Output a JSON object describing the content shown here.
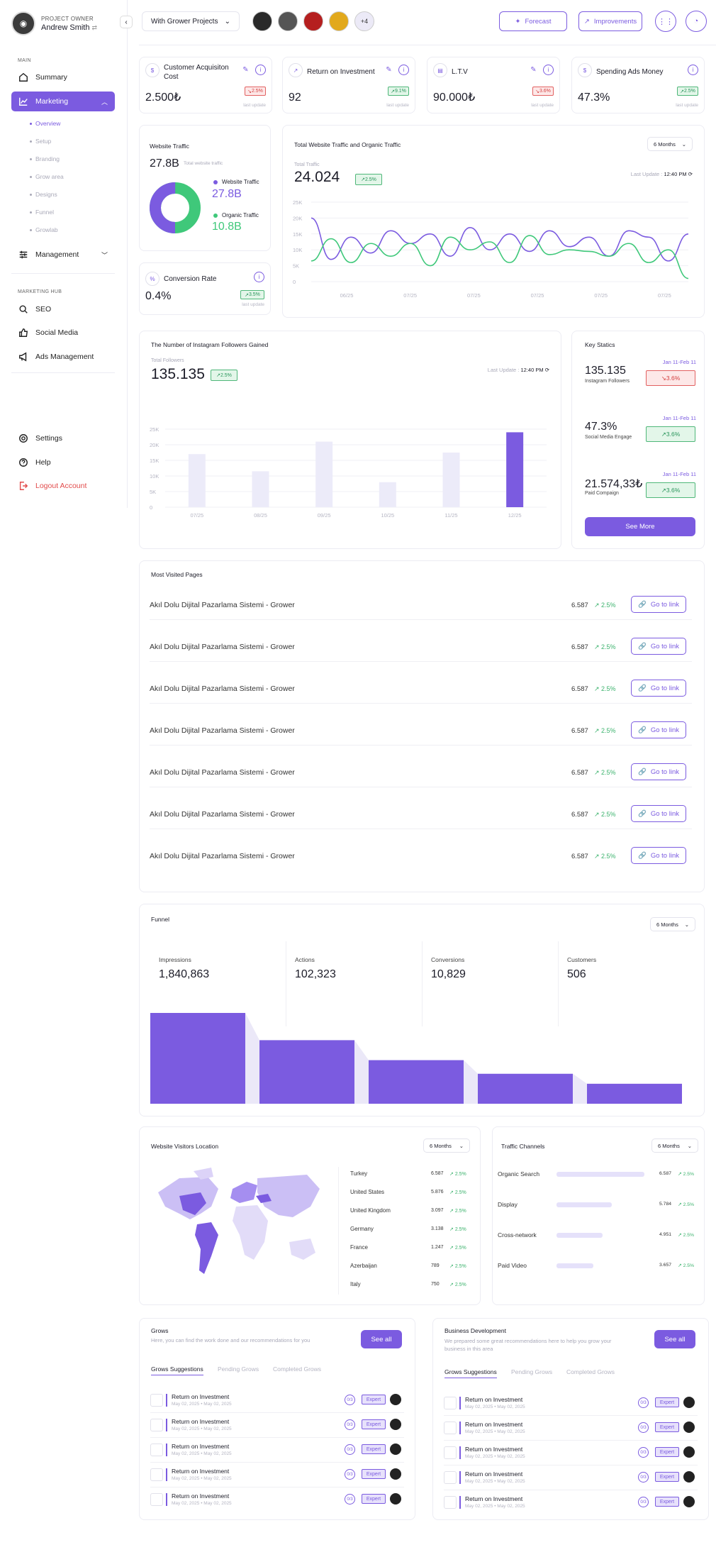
{
  "user": {
    "role": "PROJECT OWNER",
    "name": "Andrew Smith"
  },
  "nav": {
    "main_label": "MAIN",
    "summary": "Summary",
    "marketing": "Marketing",
    "sub": [
      "Overview",
      "Setup",
      "Branding",
      "Grow area",
      "Designs",
      "Funnel",
      "Growlab"
    ],
    "management": "Management",
    "hub_label": "MARKETING HUB",
    "seo": "SEO",
    "social": "Social Media",
    "ads": "Ads Management",
    "settings": "Settings",
    "help": "Help",
    "logout": "Logout Account"
  },
  "topbar": {
    "project": "With Grower Projects",
    "more_people": "+4",
    "forecast": "Forecast",
    "improvements": "Improvements"
  },
  "kpis": [
    {
      "title": "Customer Acquisiton Cost",
      "value": "2.500₺",
      "change": "2.5%",
      "dir": "down",
      "note": "last update",
      "icon": "$"
    },
    {
      "title": "Return on Investment",
      "value": "92",
      "change": "9.1%",
      "dir": "up",
      "note": "last update",
      "icon": "↗"
    },
    {
      "title": "L.T.V",
      "value": "90.000₺",
      "change": "3.6%",
      "dir": "down",
      "note": "last update",
      "icon": "▤"
    },
    {
      "title": "Spending Ads Money",
      "value": "47.3%",
      "change": "2.5%",
      "dir": "up",
      "note": "last update",
      "icon": "$"
    }
  ],
  "website_traffic": {
    "title": "Website Traffic",
    "total": "27.8B",
    "total_label": "Total website traffic",
    "legend": [
      {
        "label": "Website Traffic",
        "value": "27.8B",
        "color": "#7b5be0"
      },
      {
        "label": "Organic Traffic",
        "value": "10.8B",
        "color": "#3fc87a"
      }
    ]
  },
  "conversion": {
    "title": "Conversion Rate",
    "value": "0.4%",
    "change": "3.5%",
    "note": "last update"
  },
  "traffic_chart": {
    "title": "Total Website Traffic and Organic Traffic",
    "period": "6 Months",
    "sub": "Total Traffic",
    "value": "24.024",
    "change": "2.5%",
    "last_update_label": "Last Update :",
    "last_update": "12:40 PM"
  },
  "instagram": {
    "title": "The Number of Instagram Followers Gained",
    "sub": "Total Followers",
    "value": "135.135",
    "change": "2.5%",
    "last_update_label": "Last Update :",
    "last_update": "12:40 PM"
  },
  "key_statics": {
    "title": "Key Statics",
    "items": [
      {
        "value": "135.135",
        "label": "Instagram Followers",
        "date": "Jan 11-Feb 11",
        "change": "3.6%",
        "dir": "down"
      },
      {
        "value": "47.3%",
        "label": "Social Media Engage",
        "date": "Jan 11-Feb 11",
        "change": "3.6%",
        "dir": "up"
      },
      {
        "value": "21.574,33₺",
        "label": "Paid Compaign",
        "date": "Jan 11-Feb 11",
        "change": "3.6%",
        "dir": "up"
      }
    ],
    "see_more": "See More"
  },
  "most_visited": {
    "title": "Most Visited Pages",
    "link_label": "Go to link",
    "rows": [
      {
        "page": "Akıl Dolu Dijital Pazarlama Sistemi - Grower",
        "count": "6.587",
        "change": "2.5%"
      },
      {
        "page": "Akıl Dolu Dijital Pazarlama Sistemi - Grower",
        "count": "6.587",
        "change": "2.5%"
      },
      {
        "page": "Akıl Dolu Dijital Pazarlama Sistemi - Grower",
        "count": "6.587",
        "change": "2.5%"
      },
      {
        "page": "Akıl Dolu Dijital Pazarlama Sistemi - Grower",
        "count": "6.587",
        "change": "2.5%"
      },
      {
        "page": "Akıl Dolu Dijital Pazarlama Sistemi - Grower",
        "count": "6.587",
        "change": "2.5%"
      },
      {
        "page": "Akıl Dolu Dijital Pazarlama Sistemi - Grower",
        "count": "6.587",
        "change": "2.5%"
      },
      {
        "page": "Akıl Dolu Dijital Pazarlama Sistemi - Grower",
        "count": "6.587",
        "change": "2.5%"
      }
    ]
  },
  "funnel": {
    "title": "Funnel",
    "period": "6 Months",
    "stages": [
      {
        "label": "Impressions",
        "value": "1,840,863"
      },
      {
        "label": "Actions",
        "value": "102,323"
      },
      {
        "label": "Conversions",
        "value": "10,829"
      },
      {
        "label": "Customers",
        "value": "506"
      }
    ]
  },
  "visitors_location": {
    "title": "Website Visitors Location",
    "period": "6 Months",
    "rows": [
      {
        "country": "Turkey",
        "value": "6.587",
        "change": "2.5%"
      },
      {
        "country": "United States",
        "value": "5.876",
        "change": "2.5%"
      },
      {
        "country": "United Kingdom",
        "value": "3.097",
        "change": "2.5%"
      },
      {
        "country": "Germany",
        "value": "3.138",
        "change": "2.5%"
      },
      {
        "country": "France",
        "value": "1.247",
        "change": "2.5%"
      },
      {
        "country": "Azerbaijan",
        "value": "789",
        "change": "2.5%"
      },
      {
        "country": "Italy",
        "value": "750",
        "change": "2.5%"
      }
    ]
  },
  "traffic_channels": {
    "title": "Traffic Channels",
    "period": "6 Months",
    "rows": [
      {
        "name": "Organic Search",
        "value": "6.587",
        "change": "2.5%",
        "fill": 0.95
      },
      {
        "name": "Display",
        "value": "5.784",
        "change": "2.5%",
        "fill": 0.6
      },
      {
        "name": "Cross-network",
        "value": "4.951",
        "change": "2.5%",
        "fill": 0.5
      },
      {
        "name": "Paid Video",
        "value": "3.657",
        "change": "2.5%",
        "fill": 0.4
      }
    ]
  },
  "grows": {
    "title": "Grows",
    "sub": "Here, you can find the work done and our recommendations for you",
    "see_all": "See all",
    "tabs": [
      "Grows Suggestions",
      "Pending Grows",
      "Completed Grows"
    ],
    "items": [
      {
        "title": "Return on Investment",
        "start": "May 02, 2025",
        "end": "May 02, 2025"
      },
      {
        "title": "Return on Investment",
        "start": "May 02, 2025",
        "end": "May 02, 2025"
      },
      {
        "title": "Return on Investment",
        "start": "May 02, 2025",
        "end": "May 02, 2025"
      },
      {
        "title": "Return on Investment",
        "start": "May 02, 2025",
        "end": "May 02, 2025"
      },
      {
        "title": "Return on Investment",
        "start": "May 02, 2025",
        "end": "May 02, 2025"
      }
    ],
    "expert": "Expert",
    "ring": "0/3"
  },
  "business": {
    "title": "Business Development",
    "sub": "We prepared some great recommendations here to help you grow your business in this area",
    "see_all": "See all",
    "tabs": [
      "Grows Suggestions",
      "Pending Grows",
      "Completed Grows"
    ],
    "items": [
      {
        "title": "Return on Investment",
        "start": "May 02, 2025",
        "end": "May 02, 2025"
      },
      {
        "title": "Return on Investment",
        "start": "May 02, 2025",
        "end": "May 02, 2025"
      },
      {
        "title": "Return on Investment",
        "start": "May 02, 2025",
        "end": "May 02, 2025"
      },
      {
        "title": "Return on Investment",
        "start": "May 02, 2025",
        "end": "May 02, 2025"
      },
      {
        "title": "Return on Investment",
        "start": "May 02, 2025",
        "end": "May 02, 2025"
      }
    ],
    "expert": "Expert",
    "ring": "0/3"
  },
  "colors": {
    "accent": "#7b5be0",
    "green": "#3fc87a",
    "red": "#e26161"
  },
  "chart_data": [
    {
      "type": "line",
      "title": "Total Website Traffic and Organic Traffic",
      "x": [
        "06/25",
        "07/25",
        "07/25",
        "07/25",
        "07/25",
        "07/25"
      ],
      "yticks": [
        "25K",
        "20K",
        "15K",
        "10K",
        "5K",
        "0"
      ],
      "ylim": [
        0,
        25000
      ],
      "series": [
        {
          "name": "Website Traffic",
          "color": "#7b5be0",
          "values": [
            20000,
            7000,
            14000,
            9000,
            16000,
            12000,
            15000,
            8000,
            17000,
            10000,
            15000,
            9500,
            16000,
            11000,
            14000,
            8000,
            16000,
            14000,
            6500,
            15000
          ]
        },
        {
          "name": "Organic Traffic",
          "color": "#3fc87a",
          "values": [
            6500,
            13500,
            6000,
            12000,
            8000,
            12000,
            5000,
            14000,
            10000,
            12500,
            6000,
            14500,
            8500,
            10000,
            9500,
            8000,
            12000,
            6000,
            10000,
            1000
          ]
        }
      ]
    },
    {
      "type": "bar",
      "title": "The Number of Instagram Followers Gained",
      "categories": [
        "07/25",
        "08/25",
        "09/25",
        "10/25",
        "11/25",
        "12/25"
      ],
      "yticks": [
        "25K",
        "20K",
        "15K",
        "10K",
        "5K",
        "0"
      ],
      "ylim": [
        0,
        25000
      ],
      "values": [
        17000,
        11500,
        21000,
        8000,
        17500,
        24000
      ],
      "highlight_index": 5
    },
    {
      "type": "bar",
      "title": "Funnel",
      "categories": [
        "Impressions",
        "Actions",
        "Conversions",
        "Customers"
      ],
      "values": [
        1840863,
        102323,
        10829,
        506
      ],
      "relative_heights": [
        1.0,
        0.7,
        0.48,
        0.33,
        0.22
      ]
    },
    {
      "type": "pie",
      "title": "Website Traffic",
      "slices": [
        {
          "label": "Website Traffic",
          "value": 27.8,
          "color": "#7b5be0"
        },
        {
          "label": "Organic Traffic",
          "value": 10.8,
          "color": "#3fc87a"
        }
      ]
    }
  ]
}
